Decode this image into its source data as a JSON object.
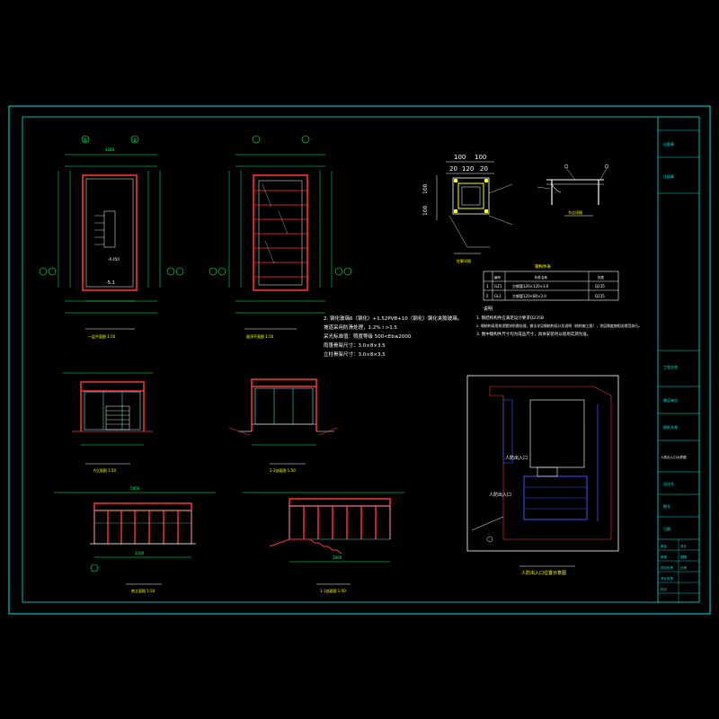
{
  "colors": {
    "background": "#000000",
    "frame": "#00e5e5",
    "outline": "#ffffff",
    "dimension": "#00ff66",
    "wall": "#ff3333",
    "glass": "#55ccdd",
    "note": "#ffff00",
    "site_blue": "#3355ff",
    "site_building": "#cccccc"
  },
  "drawing": {
    "numbers": {
      "n1": "3200",
      "n2": "100",
      "n3": "100",
      "n4": "20",
      "n5": "120",
      "n6": "20",
      "n7": "100",
      "n8": "100",
      "n9": "5800",
      "n10": "3200",
      "n11": "5800",
      "n12": "-0.450",
      "n13": "-5.1"
    },
    "axes": {
      "a1": "①",
      "a2": "②",
      "aA": "Ⓐ",
      "aB": "Ⓑ"
    },
    "notes": {
      "line1": "2.  钢化玻璃6（钢化）+1.52PVB+10（钢化）钢化夹胶玻璃。",
      "line2": "  坡道采用防滑处理，1:2%  i >1.5",
      "line3": "  采光标准值：照度等级 500<Eb≤2000",
      "line4": "  雨篷骨架尺寸：3.0×8×3.5",
      "line5": "  立柱骨架尺寸：3.0×8×3.5"
    },
    "remarks": {
      "head": "说明",
      "line1": "1. 钢结构构件应满足设计要求Q235B",
      "line2": "2. 钢结构采用热浸镀锌防腐处理，做法详见钢结构设计总说明（结构施工图），涂层厚度按相关规范执行。",
      "line3": "3. 图中钢构件尺寸均为成品尺寸，具体安装时以现场实测为准。"
    },
    "table": {
      "title": "钢构件表",
      "headers": [
        "编号",
        "构件名称",
        "材质"
      ],
      "rows": [
        [
          "1",
          "GZ1",
          "方钢管120×120×3.0",
          "Q235"
        ],
        [
          "2",
          "GL1",
          "方钢管120×80×3.0",
          "Q235"
        ]
      ]
    },
    "captions": {
      "plan1": "一层平面图 1:50",
      "plan2": "屋顶平面图 1:50",
      "elevA": "A立面图 1:50",
      "elev22": "2-2剖面图 1:50",
      "elevS": "南立面图 1:50",
      "elev11": "1-1剖面图 1:50",
      "detail1": "柱脚详图",
      "detail2": "节点详图",
      "site": "人防出入口位置示意图"
    },
    "site_labels": {
      "l1": "人防出入口",
      "l2": "人防出入口"
    }
  },
  "title_block": {
    "t1": "工程名称",
    "t2": "建设单位",
    "t3": "图纸名称",
    "t4": "人防出入口大样图",
    "t5": "设计号",
    "t6": "图号",
    "t7": "日期",
    "t8": "比例",
    "sign": [
      "审定",
      "审核",
      "项目负责",
      "专业负责",
      "校对",
      "设计",
      "制图"
    ],
    "stamp": "出图章",
    "stamp2": "注册章"
  }
}
